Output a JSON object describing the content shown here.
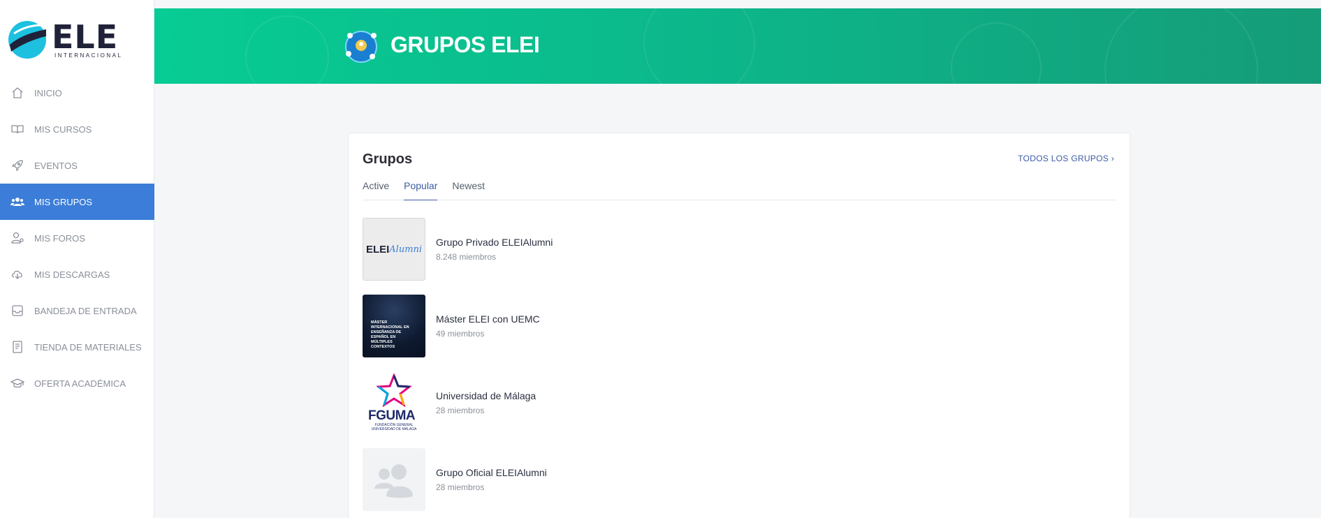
{
  "brand": {
    "name": "ELE",
    "subtitle": "INTERNACIONAL"
  },
  "nav": {
    "items": [
      {
        "label": "INICIO",
        "icon": "home-icon",
        "active": false
      },
      {
        "label": "MIS CURSOS",
        "icon": "book-icon",
        "active": false
      },
      {
        "label": "EVENTOS",
        "icon": "rocket-icon",
        "active": false
      },
      {
        "label": "MIS GRUPOS",
        "icon": "users-icon",
        "active": true
      },
      {
        "label": "MIS FOROS",
        "icon": "user-forum-icon",
        "active": false
      },
      {
        "label": "MIS DESCARGAS",
        "icon": "cloud-download-icon",
        "active": false
      },
      {
        "label": "BANDEJA DE ENTRADA",
        "icon": "inbox-icon",
        "active": false
      },
      {
        "label": "TIENDA DE MATERIALES",
        "icon": "document-icon",
        "active": false
      },
      {
        "label": "OFERTA ACADÉMICA",
        "icon": "graduation-cap-icon",
        "active": false
      }
    ]
  },
  "banner": {
    "title": "GRUPOS ELEI",
    "icon": "groups-globe-icon"
  },
  "card": {
    "title": "Grupos",
    "all_link": "TODOS LOS GRUPOS",
    "tabs": [
      {
        "label": "Active",
        "active": false
      },
      {
        "label": "Popular",
        "active": true
      },
      {
        "label": "Newest",
        "active": false
      }
    ],
    "groups": [
      {
        "name": "Grupo Privado ELEIAlumni",
        "members": "8.248 miembros",
        "thumb": {
          "text1": "ELEI",
          "text2": "Alumni"
        }
      },
      {
        "name": "Máster ELEI con UEMC",
        "members": "49 miembros",
        "thumb": {
          "text": "MÁSTER INTERNACIONAL EN ENSEÑANZA DE ESPAÑOL EN MÚLTIPLES CONTEXTOS"
        }
      },
      {
        "name": "Universidad de Málaga",
        "members": "28 miembros",
        "thumb": {
          "text": "FGUMA",
          "sub": "FUNDACIÓN GENERAL UNIVERSIDAD DE MÁLAGA"
        }
      },
      {
        "name": "Grupo Oficial ELEIAlumni",
        "members": "28 miembros",
        "thumb": {
          "icon": "default-group-avatar-icon"
        }
      }
    ]
  },
  "colors": {
    "accent": "#3b7dd8",
    "banner_start": "#07cc93",
    "banner_end": "#159c78",
    "link": "#3b5ba5"
  }
}
